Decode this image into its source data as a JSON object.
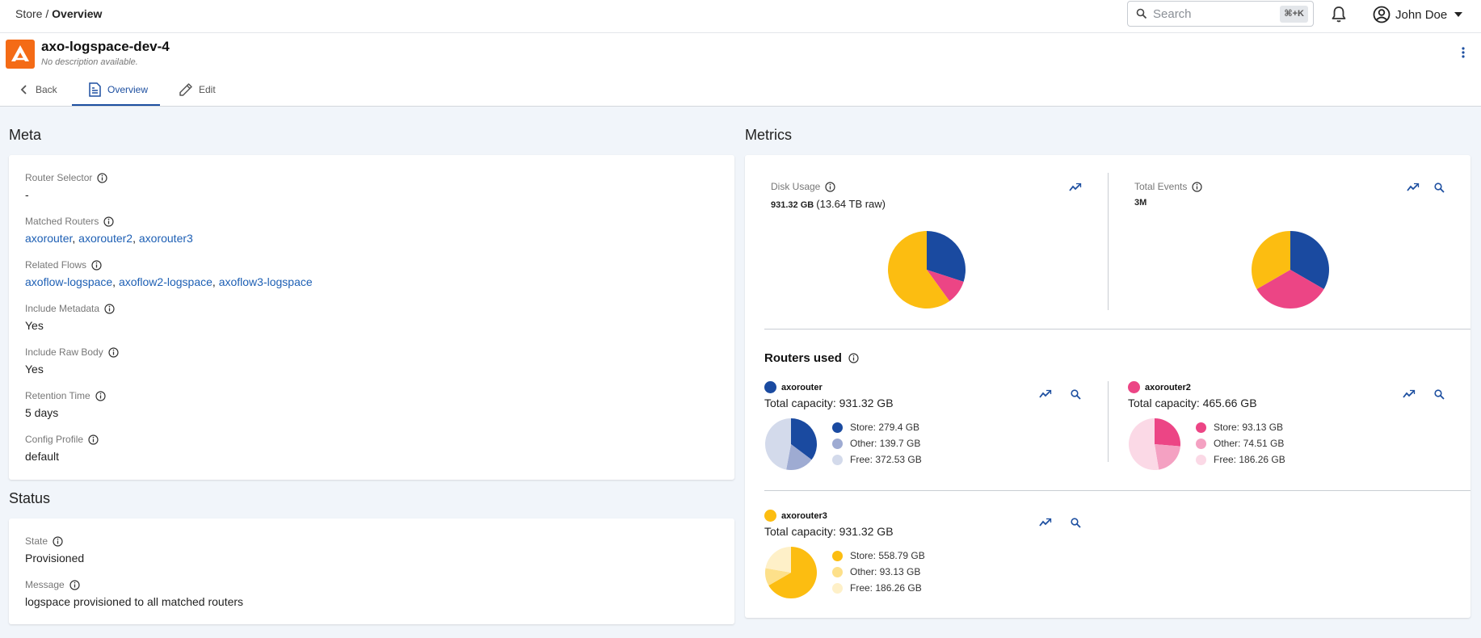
{
  "breadcrumb": {
    "root": "Store",
    "separator": "/",
    "current": "Overview"
  },
  "search": {
    "placeholder": "Search",
    "shortcut": "⌘+K"
  },
  "user": {
    "name": "John Doe"
  },
  "header": {
    "title": "axo-logspace-dev-4",
    "subtitle": "No description available."
  },
  "tabs": [
    {
      "label": "Back",
      "icon": "chevron-left-icon"
    },
    {
      "label": "Overview",
      "icon": "document-icon",
      "active": true
    },
    {
      "label": "Edit",
      "icon": "pencil-icon"
    }
  ],
  "meta": {
    "title": "Meta",
    "router_selector": {
      "label": "Router Selector",
      "value": "-"
    },
    "matched_routers": {
      "label": "Matched Routers",
      "values": [
        "axorouter",
        "axorouter2",
        "axorouter3"
      ]
    },
    "related_flows": {
      "label": "Related Flows",
      "values": [
        "axoflow-logspace",
        "axoflow2-logspace",
        "axoflow3-logspace"
      ]
    },
    "include_metadata": {
      "label": "Include Metadata",
      "value": "Yes"
    },
    "include_raw_body": {
      "label": "Include Raw Body",
      "value": "Yes"
    },
    "retention_time": {
      "label": "Retention Time",
      "value": "5 days"
    },
    "config_profile": {
      "label": "Config Profile",
      "value": "default"
    }
  },
  "status": {
    "title": "Status",
    "state": {
      "label": "State",
      "value": "Provisioned"
    },
    "message": {
      "label": "Message",
      "value": "logspace provisioned to all matched routers"
    }
  },
  "metrics": {
    "title": "Metrics",
    "disk_usage": {
      "label": "Disk Usage",
      "value": "931.32 GB",
      "raw": "(13.64 TB raw)"
    },
    "total_events": {
      "label": "Total Events",
      "value": "3M"
    },
    "routers_title": "Routers used"
  },
  "colors": {
    "blue": "#1a4aa0",
    "pink": "#ec4585",
    "yellow": "#fcbd11",
    "blue_mid": "#9eabd2",
    "blue_light": "#d3daeb",
    "pink_mid": "#f4a1c2",
    "pink_light": "#fbd9e6",
    "yellow_mid": "#fde08a",
    "yellow_light": "#fef0c8",
    "link": "#1d5fb4"
  },
  "chart_data": [
    {
      "type": "pie",
      "title": "Disk Usage",
      "labels": [
        "axorouter",
        "axorouter2",
        "axorouter3"
      ],
      "values": [
        279.4,
        93.13,
        558.79
      ],
      "colors": [
        "#1a4aa0",
        "#ec4585",
        "#fcbd11"
      ]
    },
    {
      "type": "pie",
      "title": "Total Events",
      "labels": [
        "axorouter",
        "axorouter2",
        "axorouter3"
      ],
      "values": [
        1,
        1,
        1
      ],
      "colors": [
        "#1a4aa0",
        "#ec4585",
        "#fcbd11"
      ]
    },
    {
      "type": "pie",
      "title": "axorouter",
      "capacity": "Total capacity: 931.32 GB",
      "labels": [
        "Store: 279.4 GB",
        "Other: 139.7 GB",
        "Free: 372.53 GB"
      ],
      "values": [
        279.4,
        139.7,
        372.53
      ],
      "colors": [
        "#1a4aa0",
        "#9eabd2",
        "#d3daeb"
      ]
    },
    {
      "type": "pie",
      "title": "axorouter2",
      "capacity": "Total capacity: 465.66 GB",
      "labels": [
        "Store: 93.13 GB",
        "Other: 74.51 GB",
        "Free: 186.26 GB"
      ],
      "values": [
        93.13,
        74.51,
        186.26
      ],
      "colors": [
        "#ec4585",
        "#f4a1c2",
        "#fbd9e6"
      ]
    },
    {
      "type": "pie",
      "title": "axorouter3",
      "capacity": "Total capacity: 931.32 GB",
      "labels": [
        "Store: 558.79 GB",
        "Other: 93.13 GB",
        "Free: 186.26 GB"
      ],
      "values": [
        558.79,
        93.13,
        186.26
      ],
      "colors": [
        "#fcbd11",
        "#fde08a",
        "#fef0c8"
      ]
    }
  ]
}
